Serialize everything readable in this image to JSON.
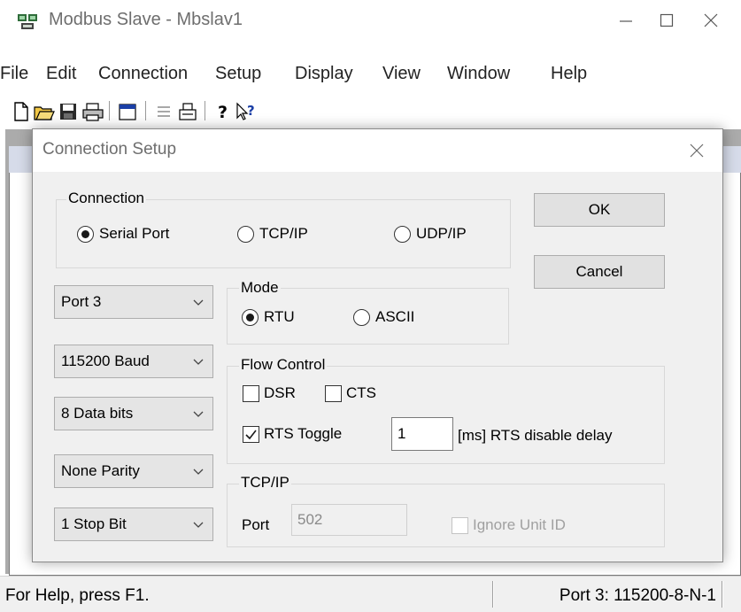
{
  "app": {
    "title": "Modbus Slave - Mbslav1"
  },
  "menu": [
    "File",
    "Edit",
    "Connection",
    "Setup",
    "Display",
    "View",
    "Window",
    "Help"
  ],
  "toolbar_icons": [
    "new-file-icon",
    "open-folder-icon",
    "save-icon",
    "print-icon",
    "window-icon",
    "list-icon",
    "printer-icon",
    "help-icon",
    "context-help-icon"
  ],
  "status": {
    "help": "For Help, press F1.",
    "port": "Port 3: 115200-8-N-1"
  },
  "dialog": {
    "title": "Connection Setup",
    "connection": {
      "label": "Connection",
      "options": [
        {
          "label": "Serial Port",
          "selected": true
        },
        {
          "label": "TCP/IP",
          "selected": false
        },
        {
          "label": "UDP/IP",
          "selected": false
        }
      ]
    },
    "buttons": {
      "ok": "OK",
      "cancel": "Cancel"
    },
    "serial": {
      "port": "Port 3",
      "baud": "115200 Baud",
      "data_bits": "8 Data bits",
      "parity": "None Parity",
      "stop_bits": "1 Stop Bit"
    },
    "mode": {
      "label": "Mode",
      "options": [
        {
          "label": "RTU",
          "selected": true
        },
        {
          "label": "ASCII",
          "selected": false
        }
      ]
    },
    "flow_control": {
      "label": "Flow Control",
      "dsr": {
        "label": "DSR",
        "checked": false
      },
      "cts": {
        "label": "CTS",
        "checked": false
      },
      "rts_toggle": {
        "label": "RTS Toggle",
        "checked": true
      },
      "rts_delay_value": "1",
      "rts_delay_label": "[ms] RTS disable delay"
    },
    "tcpip": {
      "label": "TCP/IP",
      "port_label": "Port",
      "port_value": "502",
      "ignore_unit_id": {
        "label": "Ignore Unit ID",
        "checked": false,
        "enabled": false
      }
    }
  }
}
